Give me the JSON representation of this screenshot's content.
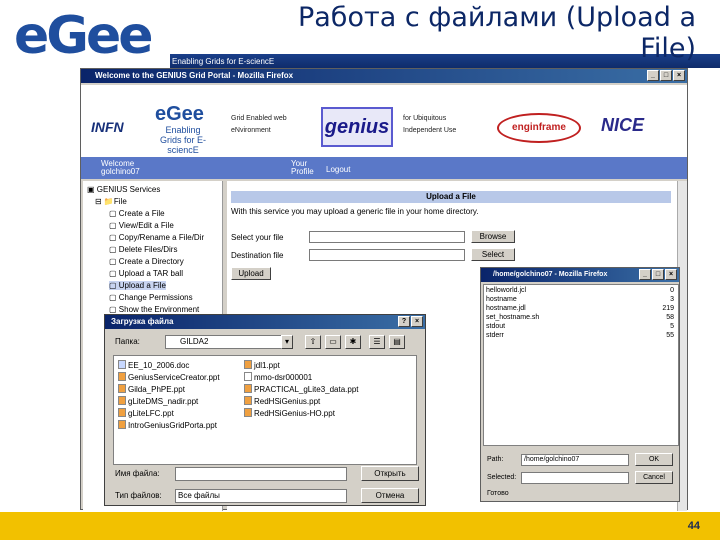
{
  "slide": {
    "logo_text": "eGee",
    "tagline": "Enabling Grids for E-sciencE",
    "title": "Работа с файлами (Upload a File)",
    "page_number": "44",
    "colors": {
      "header_blue": "#1a3f8a",
      "footer_yellow": "#f2c100"
    }
  },
  "browser": {
    "title": "Welcome to the GENIUS Grid Portal - Mozilla Firefox",
    "banner": {
      "infn": "INFN",
      "egee": "eGee",
      "egee_sub": "Enabling Grids for E-sciencE",
      "gridlab": "Grid Enabled web eNvironment",
      "genius": "genius",
      "nature": "for Ubiquitous Independent Use",
      "enginframe": "enginframe",
      "nice": "NICE"
    },
    "bluebar": {
      "welcome": "Welcome",
      "user": "golchino07",
      "your": "Your",
      "profile": "Profile",
      "logout": "Logout"
    },
    "tree": {
      "root": "GENIUS Services",
      "file": "File",
      "items": [
        "Create a File",
        "View/Edit a File",
        "Copy/Rename a File/Dir",
        "Delete Files/Dirs",
        "Create a Directory",
        "Upload a TAR ball",
        "Upload a File",
        "Change Permissions",
        "Show the Environment"
      ]
    },
    "upload": {
      "heading": "Upload a File",
      "description": "With this service you may upload a generic file in your home directory.",
      "select_label": "Select your file",
      "dest_label": "Destination file",
      "browse_button": "Browse",
      "select_button": "Select",
      "upload_button": "Upload"
    }
  },
  "list_window": {
    "title": "/home/golchino07 - Mozilla Firefox",
    "files": [
      {
        "name": "helloworld.jcl",
        "size": "0"
      },
      {
        "name": "hostname",
        "size": "3"
      },
      {
        "name": "hostname.jdl",
        "size": "219"
      },
      {
        "name": "set_hostname.sh",
        "size": "58"
      },
      {
        "name": "stdout",
        "size": "5"
      },
      {
        "name": "stderr",
        "size": "55"
      }
    ],
    "path_label": "Path:",
    "path_value": "/home/golchino07",
    "selected_label": "Selected:",
    "ok_button": "OK",
    "cancel_button": "Cancel",
    "done_label": "Готово"
  },
  "dialog": {
    "title": "Загрузка файла",
    "help_button": "?",
    "close_button": "×",
    "folder_label": "Папка:",
    "folder_value": "GILDA2",
    "files_left": [
      {
        "name": "EE_10_2006.doc",
        "icon": "doc"
      },
      {
        "name": "GeniusServiceCreator.ppt",
        "icon": "ppt"
      },
      {
        "name": "Gilda_PhPE.ppt",
        "icon": "ppt"
      },
      {
        "name": "gLiteDMS_nadir.ppt",
        "icon": "ppt"
      },
      {
        "name": "gLiteLFC.ppt",
        "icon": "ppt"
      },
      {
        "name": "IntroGeniusGridPorta.ppt",
        "icon": "ppt"
      }
    ],
    "files_right": [
      {
        "name": "jdl1.ppt",
        "icon": "ppt"
      },
      {
        "name": "mmo-dsr000001",
        "icon": "gen"
      },
      {
        "name": "PRACTICAL_gLite3_data.ppt",
        "icon": "ppt"
      },
      {
        "name": "RedHSiGenius.ppt",
        "icon": "ppt"
      },
      {
        "name": "RedHSiGenius-HO.ppt",
        "icon": "ppt"
      }
    ],
    "filename_label": "Имя файла:",
    "filetype_label": "Тип файлов:",
    "filetype_value": "Все файлы",
    "open_button": "Открыть",
    "cancel_button": "Отмена"
  }
}
